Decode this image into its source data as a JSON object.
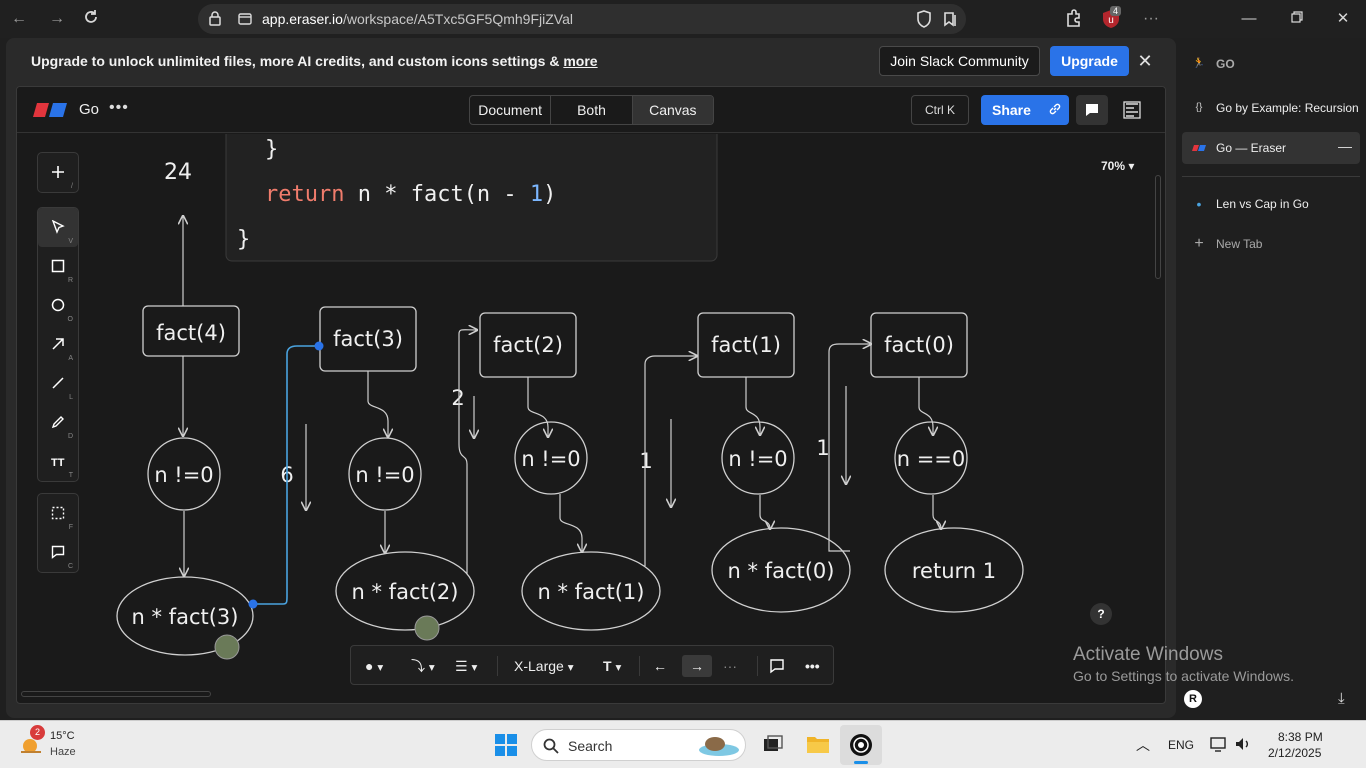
{
  "browser": {
    "url_host": "app.eraser.io",
    "url_path": "/workspace/A5Txc5GF5Qmh9FjiZVal",
    "extension_badge": "4"
  },
  "banner": {
    "text": "Upgrade to unlock unlimited files, more AI credits, and custom icons settings & ",
    "more_link": "more",
    "slack_label": "Join Slack Community",
    "upgrade_label": "Upgrade"
  },
  "eraser": {
    "doc_title": "Go",
    "views": [
      "Document",
      "Both",
      "Canvas"
    ],
    "shortcut": "Ctrl K",
    "share_label": "Share",
    "zoom": "70%",
    "tools": [
      {
        "name": "add",
        "key": "/"
      },
      {
        "name": "select",
        "key": "V"
      },
      {
        "name": "rectangle",
        "key": "R"
      },
      {
        "name": "ellipse",
        "key": "O"
      },
      {
        "name": "arrow",
        "key": "A"
      },
      {
        "name": "line",
        "key": "L"
      },
      {
        "name": "pen",
        "key": "D"
      },
      {
        "name": "text",
        "key": "T"
      },
      {
        "name": "frame",
        "key": "F"
      },
      {
        "name": "comment",
        "key": "C"
      }
    ],
    "bottombar": {
      "size": "X-Large",
      "text_tool": "T",
      "more": "···"
    }
  },
  "diagram": {
    "code_lines": [
      "}",
      "return n * fact(n - 1)",
      "}"
    ],
    "result_top": "24",
    "calls": [
      "fact(4)",
      "fact(3)",
      "fact(2)",
      "fact(1)",
      "fact(0)"
    ],
    "conditions": [
      "n !=0",
      "n !=0",
      "n !=0",
      "n !=0",
      "n ==0"
    ],
    "returns": [
      "n * fact(3)",
      "n * fact(2)",
      "n * fact(1)",
      "n * fact(0)",
      "return 1"
    ],
    "return_values": [
      "6",
      "2",
      "1",
      "1"
    ]
  },
  "sidebar": {
    "tabs": [
      {
        "icon": "runner-icon",
        "label": "GO"
      },
      {
        "icon": "code-icon",
        "label": "Go by Example: Recursion"
      },
      {
        "icon": "eraser-icon",
        "label": "Go — Eraser"
      },
      {
        "icon": "dot-icon",
        "label": "Len vs Cap in Go"
      },
      {
        "icon": "plus-icon",
        "label": "New Tab"
      }
    ]
  },
  "watermark": {
    "line1": "Activate Windows",
    "line2": "Go to Settings to activate Windows."
  },
  "taskbar": {
    "weather_temp": "15°C",
    "weather_cond": "Haze",
    "weather_badge": "2",
    "search_label": "Search",
    "lang": "ENG",
    "time": "8:38 PM",
    "date": "2/12/2025"
  },
  "colors": {
    "accent": "#2a73e8",
    "code_red": "#f07c6c",
    "code_blue": "#7cb7ff",
    "selection": "#4aa3df"
  }
}
